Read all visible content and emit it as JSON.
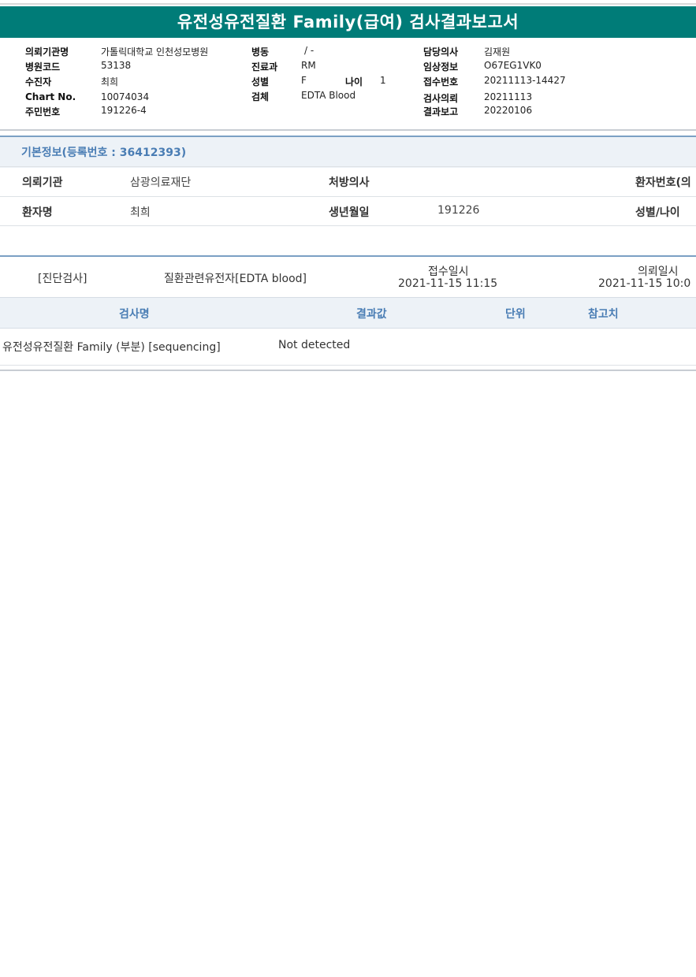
{
  "report": {
    "title": "유전성유전질환 Family(급여) 검사결과보고서"
  },
  "header": {
    "institution_label": "의뢰기관명",
    "institution_value": "가톨릭대학교 인천성모병원",
    "hospital_code_label": "병원코드",
    "hospital_code_value": "53138",
    "recipient_label": "수진자",
    "recipient_value": "최희",
    "chart_label": "Chart No.",
    "chart_value": "10074034",
    "resident_label": "주민번호",
    "resident_value": "191226-4",
    "ward_label": "병동",
    "ward_value": "/ -",
    "dept_label": "진료과",
    "dept_value": "RM",
    "sex_label": "성별",
    "sex_value": "F",
    "age_label": "나이",
    "age_value": "1",
    "specimen_label": "검체",
    "specimen_value": "EDTA Blood",
    "doctor_label": "담당의사",
    "doctor_value": "김재원",
    "clinical_label": "임상정보",
    "clinical_value": "O67EG1VK0",
    "receipt_no_label": "접수번호",
    "receipt_no_value": "20211113-14427",
    "test_request_label": "검사의뢰",
    "test_request_value": "20211113",
    "result_report_label": "결과보고",
    "result_report_value": "20220106"
  },
  "basic_info": {
    "title": "기본정보(등록번호 : 36412393)",
    "requesting_org_label": "의뢰기관",
    "requesting_org_value": "삼광의료재단",
    "prescriber_label": "처방의사",
    "prescriber_value": "",
    "patient_no_label": "환자번호(의",
    "patient_name_label": "환자명",
    "patient_name_value": "최희",
    "dob_label": "생년월일",
    "dob_value": "191226",
    "sex_age_label": "성별/나이"
  },
  "diagnosis": {
    "category": "[진단검사]",
    "test_group": "질환관련유전자[EDTA blood]",
    "receipt_dt_label": "접수일시",
    "receipt_dt_value": "2021-11-15  11:15",
    "request_dt_label": "의뢰일시",
    "request_dt_value": "2021-11-15  10:0"
  },
  "results_table": {
    "columns": [
      "검사명",
      "결과값",
      "단위",
      "참고치"
    ],
    "rows": [
      {
        "test_name": "유전성유전질환 Family (부분) [sequencing]",
        "result": "Not detected",
        "unit": "",
        "reference": ""
      }
    ]
  }
}
